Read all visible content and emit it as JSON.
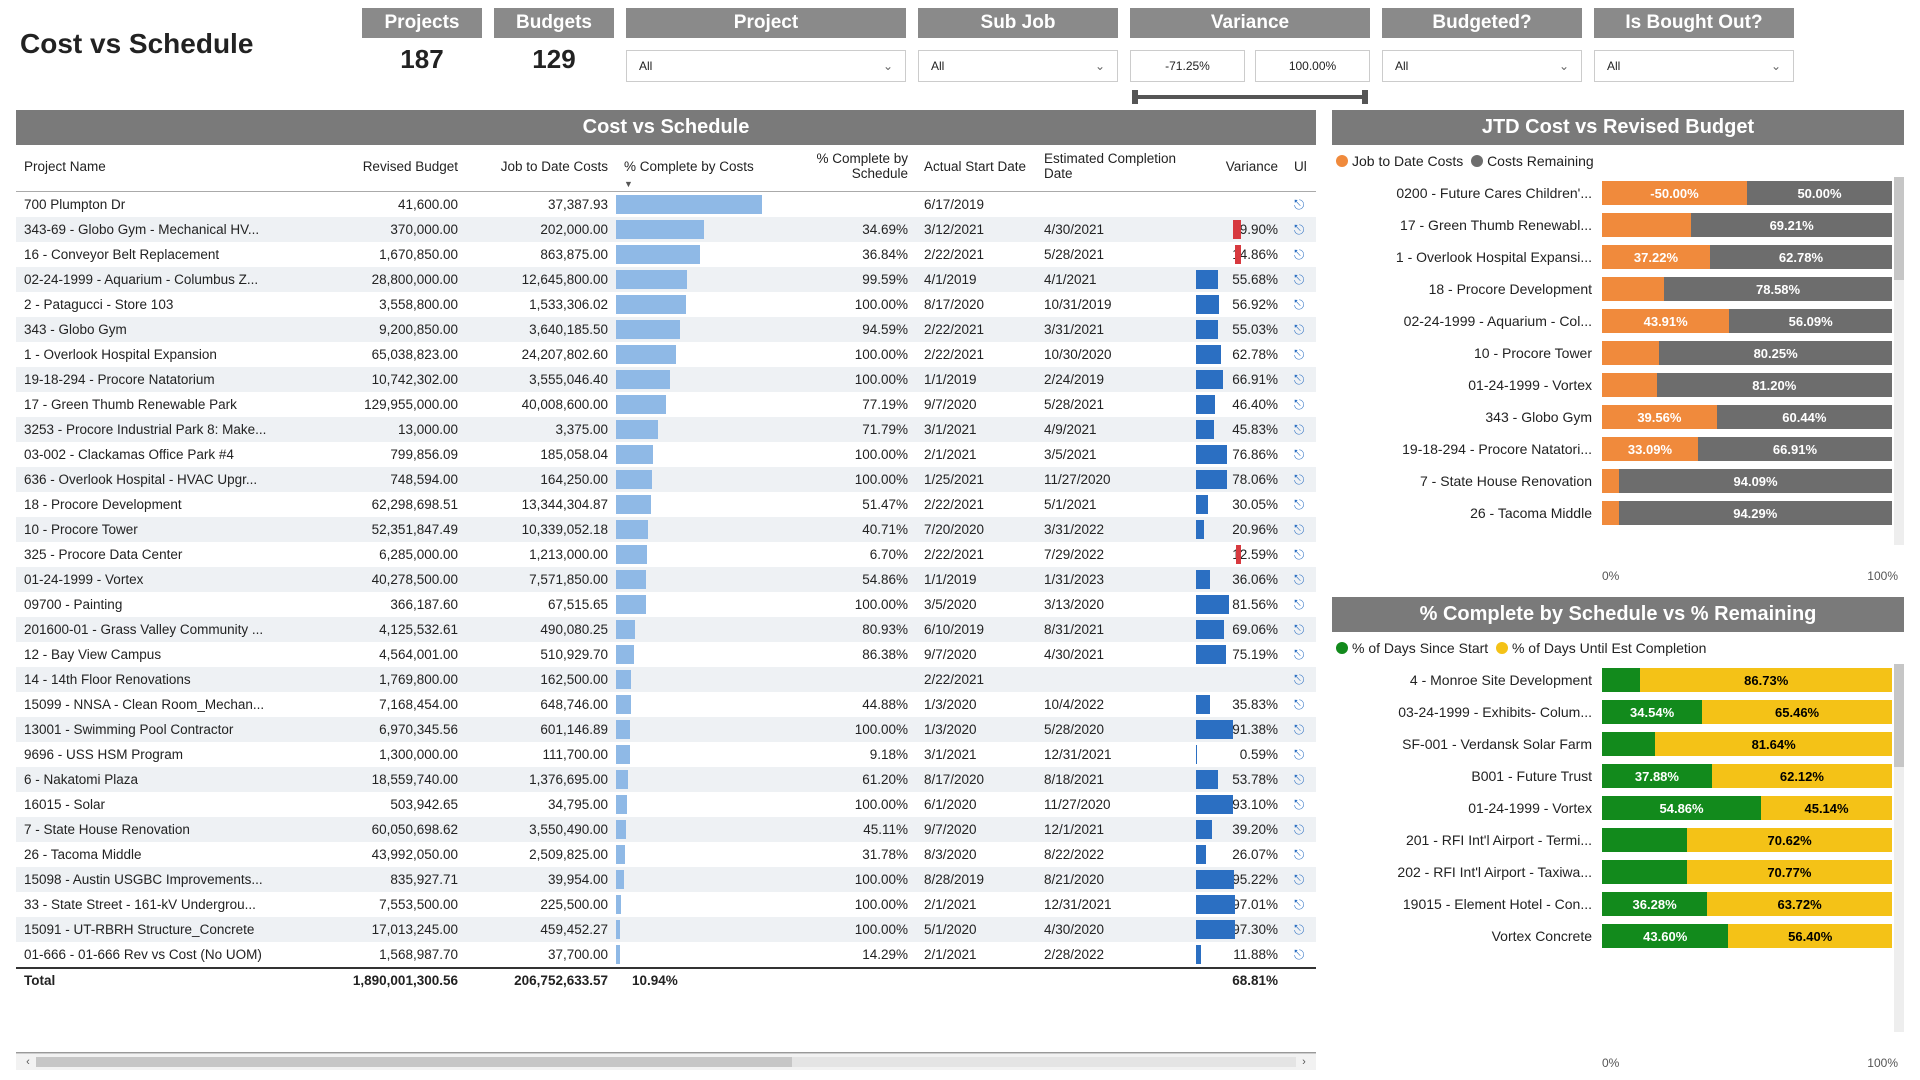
{
  "title": "Cost vs Schedule",
  "kpis": {
    "projects_label": "Projects",
    "projects_value": "187",
    "budgets_label": "Budgets",
    "budgets_value": "129"
  },
  "slicers": {
    "project_label": "Project",
    "project_value": "All",
    "subjob_label": "Sub Job",
    "subjob_value": "All",
    "variance_label": "Variance",
    "variance_min": "-71.25%",
    "variance_max": "100.00%",
    "budgeted_label": "Budgeted?",
    "budgeted_value": "All",
    "bought_label": "Is Bought Out?",
    "bought_value": "All"
  },
  "table": {
    "title": "Cost vs Schedule",
    "headers": {
      "name": "Project Name",
      "budget": "Revised Budget",
      "jtd": "Job to Date Costs",
      "pctCost": "% Complete by Costs",
      "pctSched": "% Complete by Schedule",
      "start": "Actual Start Date",
      "est": "Estimated Completion Date",
      "var": "Variance",
      "url": "Ul"
    },
    "rows": [
      {
        "name": "700 Plumpton Dr",
        "budget": "41,600.00",
        "jtd": "37,387.93",
        "pctCost": 89.87,
        "pctSched": "",
        "start": "6/17/2019",
        "est": "",
        "var": ""
      },
      {
        "name": "343-69 - Globo Gym - Mechanical HV...",
        "budget": "370,000.00",
        "jtd": "202,000.00",
        "pctCost": 54.59,
        "pctSched": "34.69%",
        "start": "3/12/2021",
        "est": "4/30/2021",
        "var": -19.9
      },
      {
        "name": "16 - Conveyor Belt Replacement",
        "budget": "1,670,850.00",
        "jtd": "863,875.00",
        "pctCost": 51.7,
        "pctSched": "36.84%",
        "start": "2/22/2021",
        "est": "5/28/2021",
        "var": -14.86
      },
      {
        "name": "02-24-1999 - Aquarium - Columbus Z...",
        "budget": "28,800,000.00",
        "jtd": "12,645,800.00",
        "pctCost": 43.91,
        "pctSched": "99.59%",
        "start": "4/1/2019",
        "est": "4/1/2021",
        "var": 55.68
      },
      {
        "name": "2 - Patagucci - Store 103",
        "budget": "3,558,800.00",
        "jtd": "1,533,306.02",
        "pctCost": 43.08,
        "pctSched": "100.00%",
        "start": "8/17/2020",
        "est": "10/31/2019",
        "var": 56.92
      },
      {
        "name": "343 - Globo Gym",
        "budget": "9,200,850.00",
        "jtd": "3,640,185.50",
        "pctCost": 39.56,
        "pctSched": "94.59%",
        "start": "2/22/2021",
        "est": "3/31/2021",
        "var": 55.03
      },
      {
        "name": "1 - Overlook Hospital Expansion",
        "budget": "65,038,823.00",
        "jtd": "24,207,802.60",
        "pctCost": 37.22,
        "pctSched": "100.00%",
        "start": "2/22/2021",
        "est": "10/30/2020",
        "var": 62.78
      },
      {
        "name": "19-18-294 - Procore Natatorium",
        "budget": "10,742,302.00",
        "jtd": "3,555,046.40",
        "pctCost": 33.09,
        "pctSched": "100.00%",
        "start": "1/1/2019",
        "est": "2/24/2019",
        "var": 66.91
      },
      {
        "name": "17 - Green Thumb Renewable Park",
        "budget": "129,955,000.00",
        "jtd": "40,008,600.00",
        "pctCost": 30.79,
        "pctSched": "77.19%",
        "start": "9/7/2020",
        "est": "5/28/2021",
        "var": 46.4
      },
      {
        "name": "3253 - Procore Industrial Park 8: Make...",
        "budget": "13,000.00",
        "jtd": "3,375.00",
        "pctCost": 25.96,
        "pctSched": "71.79%",
        "start": "3/1/2021",
        "est": "4/9/2021",
        "var": 45.83
      },
      {
        "name": "03-002 - Clackamas Office Park #4",
        "budget": "799,856.09",
        "jtd": "185,058.04",
        "pctCost": 23.14,
        "pctSched": "100.00%",
        "start": "2/1/2021",
        "est": "3/5/2021",
        "var": 76.86
      },
      {
        "name": "636 - Overlook Hospital - HVAC Upgr...",
        "budget": "748,594.00",
        "jtd": "164,250.00",
        "pctCost": 21.94,
        "pctSched": "100.00%",
        "start": "1/25/2021",
        "est": "11/27/2020",
        "var": 78.06
      },
      {
        "name": "18 - Procore Development",
        "budget": "62,298,698.51",
        "jtd": "13,344,304.87",
        "pctCost": 21.42,
        "pctSched": "51.47%",
        "start": "2/22/2021",
        "est": "5/1/2021",
        "var": 30.05
      },
      {
        "name": "10 - Procore Tower",
        "budget": "52,351,847.49",
        "jtd": "10,339,052.18",
        "pctCost": 19.75,
        "pctSched": "40.71%",
        "start": "7/20/2020",
        "est": "3/31/2022",
        "var": 20.96
      },
      {
        "name": "325 - Procore Data Center",
        "budget": "6,285,000.00",
        "jtd": "1,213,000.00",
        "pctCost": 19.3,
        "pctSched": "6.70%",
        "start": "2/22/2021",
        "est": "7/29/2022",
        "var": -12.59
      },
      {
        "name": "01-24-1999 - Vortex",
        "budget": "40,278,500.00",
        "jtd": "7,571,850.00",
        "pctCost": 18.8,
        "pctSched": "54.86%",
        "start": "1/1/2019",
        "est": "1/31/2023",
        "var": 36.06
      },
      {
        "name": "09700 - Painting",
        "budget": "366,187.60",
        "jtd": "67,515.65",
        "pctCost": 18.44,
        "pctSched": "100.00%",
        "start": "3/5/2020",
        "est": "3/13/2020",
        "var": 81.56
      },
      {
        "name": "201600-01 - Grass Valley Community ...",
        "budget": "4,125,532.61",
        "jtd": "490,080.25",
        "pctCost": 11.88,
        "pctSched": "80.93%",
        "start": "6/10/2019",
        "est": "8/31/2021",
        "var": 69.06
      },
      {
        "name": "12 - Bay View Campus",
        "budget": "4,564,001.00",
        "jtd": "510,929.70",
        "pctCost": 11.19,
        "pctSched": "86.38%",
        "start": "9/7/2020",
        "est": "4/30/2021",
        "var": 75.19
      },
      {
        "name": "14 - 14th Floor Renovations",
        "budget": "1,769,800.00",
        "jtd": "162,500.00",
        "pctCost": 9.18,
        "pctSched": "",
        "start": "2/22/2021",
        "est": "",
        "var": ""
      },
      {
        "name": "15099 - NNSA - Clean Room_Mechan...",
        "budget": "7,168,454.00",
        "jtd": "648,746.00",
        "pctCost": 9.05,
        "pctSched": "44.88%",
        "start": "1/3/2020",
        "est": "10/4/2022",
        "var": 35.83
      },
      {
        "name": "13001 - Swimming Pool Contractor",
        "budget": "6,970,345.56",
        "jtd": "601,146.89",
        "pctCost": 8.62,
        "pctSched": "100.00%",
        "start": "1/3/2020",
        "est": "5/28/2020",
        "var": 91.38
      },
      {
        "name": "9696 - USS HSM Program",
        "budget": "1,300,000.00",
        "jtd": "111,700.00",
        "pctCost": 8.59,
        "pctSched": "9.18%",
        "start": "3/1/2021",
        "est": "12/31/2021",
        "var": 0.59
      },
      {
        "name": "6 - Nakatomi Plaza",
        "budget": "18,559,740.00",
        "jtd": "1,376,695.00",
        "pctCost": 7.42,
        "pctSched": "61.20%",
        "start": "8/17/2020",
        "est": "8/18/2021",
        "var": 53.78
      },
      {
        "name": "16015 - Solar",
        "budget": "503,942.65",
        "jtd": "34,795.00",
        "pctCost": 6.9,
        "pctSched": "100.00%",
        "start": "6/1/2020",
        "est": "11/27/2020",
        "var": 93.1
      },
      {
        "name": "7 - State House Renovation",
        "budget": "60,050,698.62",
        "jtd": "3,550,490.00",
        "pctCost": 5.91,
        "pctSched": "45.11%",
        "start": "9/7/2020",
        "est": "12/1/2021",
        "var": 39.2
      },
      {
        "name": "26 - Tacoma Middle",
        "budget": "43,992,050.00",
        "jtd": "2,509,825.00",
        "pctCost": 5.71,
        "pctSched": "31.78%",
        "start": "8/3/2020",
        "est": "8/22/2022",
        "var": 26.07
      },
      {
        "name": "15098 - Austin USGBC Improvements...",
        "budget": "835,927.71",
        "jtd": "39,954.00",
        "pctCost": 4.78,
        "pctSched": "100.00%",
        "start": "8/28/2019",
        "est": "8/21/2020",
        "var": 95.22
      },
      {
        "name": "33 - State Street - 161-kV Undergrou...",
        "budget": "7,553,500.00",
        "jtd": "225,500.00",
        "pctCost": 2.99,
        "pctSched": "100.00%",
        "start": "2/1/2021",
        "est": "12/31/2021",
        "var": 97.01
      },
      {
        "name": "15091 - UT-RBRH Structure_Concrete",
        "budget": "17,013,245.00",
        "jtd": "459,452.27",
        "pctCost": 2.7,
        "pctSched": "100.00%",
        "start": "5/1/2020",
        "est": "4/30/2020",
        "var": 97.3
      },
      {
        "name": "01-666 - 01-666 Rev vs Cost (No UOM)",
        "budget": "1,568,987.70",
        "jtd": "37,700.00",
        "pctCost": 2.4,
        "pctSched": "14.29%",
        "start": "2/1/2021",
        "est": "2/28/2022",
        "var": 11.88
      }
    ],
    "total": {
      "label": "Total",
      "budget": "1,890,001,300.56",
      "jtd": "206,752,633.57",
      "pctCost": "10.94%",
      "var": "68.81%"
    }
  },
  "jtd_chart": {
    "title": "JTD Cost vs Revised Budget",
    "legend": {
      "a": "Job to Date Costs",
      "b": "Costs Remaining"
    },
    "rows": [
      {
        "label": "0200 - Future Cares Children'...",
        "a": -50.0,
        "b": 50.0,
        "aText": "-50.00%",
        "bText": "50.00%"
      },
      {
        "label": "17 - Green Thumb Renewabl...",
        "a": 30.79,
        "b": 69.21,
        "aText": "",
        "bText": "69.21%"
      },
      {
        "label": "1 - Overlook Hospital Expansi...",
        "a": 37.22,
        "b": 62.78,
        "aText": "37.22%",
        "bText": "62.78%"
      },
      {
        "label": "18 - Procore Development",
        "a": 21.42,
        "b": 78.58,
        "aText": "",
        "bText": "78.58%"
      },
      {
        "label": "02-24-1999 - Aquarium - Col...",
        "a": 43.91,
        "b": 56.09,
        "aText": "43.91%",
        "bText": "56.09%"
      },
      {
        "label": "10 - Procore Tower",
        "a": 19.75,
        "b": 80.25,
        "aText": "",
        "bText": "80.25%"
      },
      {
        "label": "01-24-1999 - Vortex",
        "a": 18.8,
        "b": 81.2,
        "aText": "",
        "bText": "81.20%"
      },
      {
        "label": "343 - Globo Gym",
        "a": 39.56,
        "b": 60.44,
        "aText": "39.56%",
        "bText": "60.44%"
      },
      {
        "label": "19-18-294 - Procore Natatori...",
        "a": 33.09,
        "b": 66.91,
        "aText": "33.09%",
        "bText": "66.91%"
      },
      {
        "label": "7 - State House Renovation",
        "a": 5.91,
        "b": 94.09,
        "aText": "",
        "bText": "94.09%"
      },
      {
        "label": "26 - Tacoma Middle",
        "a": 5.71,
        "b": 94.29,
        "aText": "",
        "bText": "94.29%"
      }
    ],
    "axis_min": "0%",
    "axis_max": "100%"
  },
  "sched_chart": {
    "title": "% Complete by Schedule vs % Remaining",
    "legend": {
      "a": "% of Days Since Start",
      "b": "% of Days Until Est Completion"
    },
    "rows": [
      {
        "label": "4 - Monroe Site Development",
        "a": 13.27,
        "b": 86.73,
        "aText": "",
        "bText": "86.73%"
      },
      {
        "label": "03-24-1999 - Exhibits- Colum...",
        "a": 34.54,
        "b": 65.46,
        "aText": "34.54%",
        "bText": "65.46%"
      },
      {
        "label": "SF-001 - Verdansk Solar Farm",
        "a": 18.36,
        "b": 81.64,
        "aText": "",
        "bText": "81.64%"
      },
      {
        "label": "B001 - Future Trust",
        "a": 37.88,
        "b": 62.12,
        "aText": "37.88%",
        "bText": "62.12%"
      },
      {
        "label": "01-24-1999 - Vortex",
        "a": 54.86,
        "b": 45.14,
        "aText": "54.86%",
        "bText": "45.14%"
      },
      {
        "label": "201 - RFI Int'l Airport - Termi...",
        "a": 29.38,
        "b": 70.62,
        "aText": "",
        "bText": "70.62%"
      },
      {
        "label": "202 - RFI Int'l Airport - Taxiwa...",
        "a": 29.23,
        "b": 70.77,
        "aText": "",
        "bText": "70.77%"
      },
      {
        "label": "19015 - Element Hotel - Con...",
        "a": 36.28,
        "b": 63.72,
        "aText": "36.28%",
        "bText": "63.72%"
      },
      {
        "label": "Vortex Concrete",
        "a": 43.6,
        "b": 56.4,
        "aText": "43.60%",
        "bText": "56.40%"
      }
    ],
    "axis_min": "0%",
    "axis_max": "100%"
  },
  "chart_data": [
    {
      "type": "bar",
      "orientation": "horizontal",
      "stacked": true,
      "title": "JTD Cost vs Revised Budget",
      "series": [
        {
          "name": "Job to Date Costs",
          "values": [
            -50.0,
            30.79,
            37.22,
            21.42,
            43.91,
            19.75,
            18.8,
            39.56,
            33.09,
            5.91,
            5.71
          ]
        },
        {
          "name": "Costs Remaining",
          "values": [
            50.0,
            69.21,
            62.78,
            78.58,
            56.09,
            80.25,
            81.2,
            60.44,
            66.91,
            94.09,
            94.29
          ]
        }
      ],
      "categories": [
        "0200 - Future Cares Children's",
        "17 - Green Thumb Renewable",
        "1 - Overlook Hospital Expansion",
        "18 - Procore Development",
        "02-24-1999 - Aquarium - Columbus",
        "10 - Procore Tower",
        "01-24-1999 - Vortex",
        "343 - Globo Gym",
        "19-18-294 - Procore Natatorium",
        "7 - State House Renovation",
        "26 - Tacoma Middle"
      ],
      "xlim": [
        0,
        100
      ],
      "xlabel": "",
      "ylabel": ""
    },
    {
      "type": "bar",
      "orientation": "horizontal",
      "stacked": true,
      "title": "% Complete by Schedule vs % Remaining",
      "series": [
        {
          "name": "% of Days Since Start",
          "values": [
            13.27,
            34.54,
            18.36,
            37.88,
            54.86,
            29.38,
            29.23,
            36.28,
            43.6
          ]
        },
        {
          "name": "% of Days Until Est Completion",
          "values": [
            86.73,
            65.46,
            81.64,
            62.12,
            45.14,
            70.62,
            70.77,
            63.72,
            56.4
          ]
        }
      ],
      "categories": [
        "4 - Monroe Site Development",
        "03-24-1999 - Exhibits- Columbus",
        "SF-001 - Verdansk Solar Farm",
        "B001 - Future Trust",
        "01-24-1999 - Vortex",
        "201 - RFI Int'l Airport - Terminal",
        "202 - RFI Int'l Airport - Taxiway",
        "19015 - Element Hotel - Concrete",
        "Vortex Concrete"
      ],
      "xlim": [
        0,
        100
      ],
      "xlabel": "",
      "ylabel": ""
    }
  ]
}
